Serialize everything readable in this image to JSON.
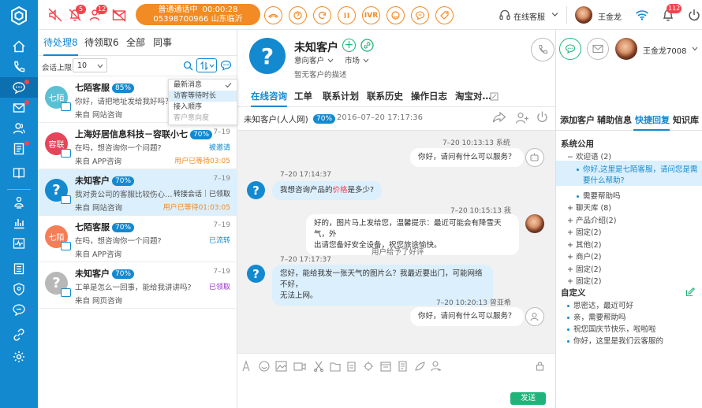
{
  "topbar": {
    "badges": {
      "mute": "",
      "bell": "5",
      "users": "12",
      "inbox": ""
    },
    "call_status": "普通通话中",
    "call_timer": "00:00:28",
    "call_number": "05398700966 山东临沂",
    "ivr_label": "IVR",
    "online_status": "在线客服",
    "user_name": "王金龙",
    "notif_count": "112"
  },
  "list": {
    "tabs": [
      "待处理8",
      "待领取6",
      "全部",
      "同事"
    ],
    "limit_label": "会话上限",
    "limit_value": "10",
    "sort_options": [
      "最新消息",
      "访客等待时长",
      "接入顺序",
      "客户意向度"
    ],
    "conversations": [
      {
        "avatar_text": "七陌",
        "avatar_color": "#5bc0d4",
        "name": "七陌客服",
        "pct": "85%",
        "date": "",
        "message": "你好，请把地址发给我好吗？",
        "status": "",
        "status_color": "#666",
        "source": "来自 网站咨询",
        "wait": ""
      },
      {
        "avatar_text": "容联",
        "avatar_color": "#e5455a",
        "name": "上海好居信息科技－容联小七",
        "pct": "70%",
        "date": "7–19",
        "message": "在吗，想咨询你一个问题?",
        "status": "被邀请",
        "status_color": "#1389d0",
        "source": "来自 APP咨询",
        "wait": "用户已等待03:05"
      },
      {
        "avatar_text": "?",
        "avatar_color": "#1389d0",
        "name": "未知客户",
        "pct": "70%",
        "date": "7–19",
        "message": "我对贵公司的客服比较伤心…",
        "status": "转接会话｜已领取",
        "status_color": "#444",
        "source": "来自 网站咨询",
        "wait": "用户已等待01:03:05"
      },
      {
        "avatar_text": "七陌",
        "avatar_color": "#f47f57",
        "name": "七陌客服",
        "pct": "70%",
        "date": "7–19",
        "message": "在吗，想咨询你一个问题?",
        "status": "已流转",
        "status_color": "#1389d0",
        "source": "来自 APP咨询",
        "wait": ""
      },
      {
        "avatar_text": "?",
        "avatar_color": "#b8b8b8",
        "name": "未知客户",
        "pct": "70%",
        "date": "7–19",
        "message": "工单是怎么一回事，能给我讲讲吗?",
        "status": "已领取",
        "status_color": "#9b30c8",
        "source": "来自 网页咨询",
        "wait": ""
      }
    ]
  },
  "customer": {
    "name": "未知客户",
    "intent_label": "意向客户",
    "market_label": "市场",
    "description": "暂无客户的描述",
    "agent_name": "王金龙7008",
    "tabs": [
      "在线咨询",
      "工单",
      "联系计划",
      "联系历史",
      "操作日志",
      "淘宝对…"
    ]
  },
  "chat": {
    "header_name": "未知客户(人人网)",
    "header_pct": "70%",
    "header_time": "2016–07–20 17:17:36",
    "messages": [
      {
        "meta": "7–20  10:13:13  系统",
        "text": "你好，请问有什么可以服务？"
      },
      {
        "meta": "7–20  17:14:37",
        "text_pre": "我想咨询产品的",
        "text_highlight": "价格",
        "text_post": "是多少?"
      },
      {
        "meta": "7–20  10:15:13  我",
        "line1": "好的，图片马上发给您，温馨提示：最近可能会有降雪天气，外",
        "line2": "出请您备好安全设备，祝您旅途愉快。"
      },
      {
        "notice": "用户给予了好评"
      },
      {
        "meta": "7–20  17:17:37",
        "line1": "您好，能给我发一张天气的图片么？我最近要出门，可能网络不好，",
        "line2": "无法上网。"
      },
      {
        "meta": "7–20  10:20:13  曾亚希",
        "text": "你好，请问有什么可以服务？"
      }
    ],
    "send_label": "发送"
  },
  "right": {
    "tabs": [
      "添加客户",
      "辅助信息",
      "快捷回复",
      "知识库"
    ],
    "public_title": "系统公用",
    "public_tree": [
      {
        "label": "− 欢迎语 (2)",
        "kind": "folder-open"
      },
      {
        "label": "你好,这里是七陌客服，请问您是需",
        "label2": "要什么帮助?",
        "kind": "leaf-selected"
      },
      {
        "label": "需要帮助吗",
        "kind": "leaf"
      },
      {
        "label": "+ 聊天库 (8)",
        "kind": "folder"
      },
      {
        "label": "+ 产品介绍(2)",
        "kind": "folder"
      },
      {
        "label": "+ 固定(2)",
        "kind": "folder"
      },
      {
        "label": "+ 其他(2)",
        "kind": "folder"
      },
      {
        "label": "+ 商户(2)",
        "kind": "folder"
      },
      {
        "label": "+ 固定(2)",
        "kind": "folder"
      },
      {
        "label": "+ 固定(2)",
        "kind": "folder"
      }
    ],
    "custom_title": "自定义",
    "custom_items": [
      "思密达，最近可好",
      "亲，需要帮助吗",
      "祝您国庆节快乐，啦啦啦",
      "你好，这里是我们云客服的"
    ]
  },
  "colors": {
    "brand": "#1389d0",
    "accent": "#f28b23",
    "alert": "#f3434d",
    "send": "#1fb47a"
  }
}
